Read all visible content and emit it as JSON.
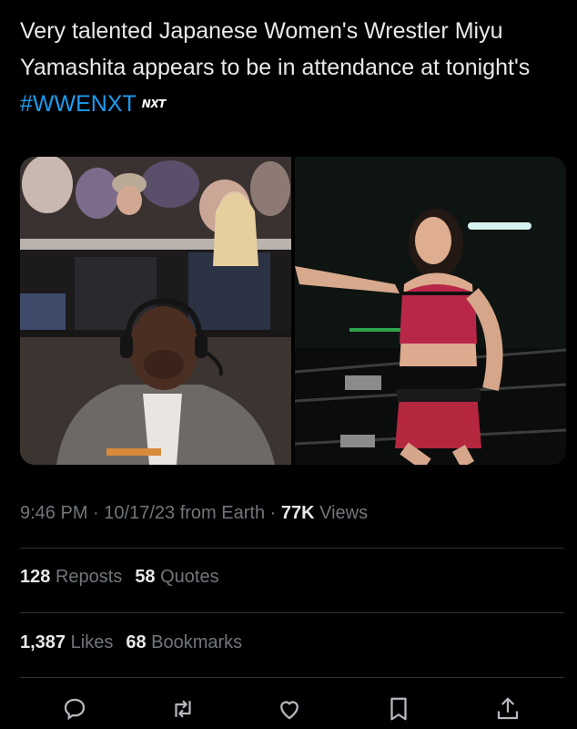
{
  "tweet": {
    "text_before_hashtag": "Very talented Japanese Women's Wrestler Miyu Yamashita appears to be in attendance at tonight's ",
    "hashtag": "#WWENXT",
    "hashtag_badge": "NXT"
  },
  "media": {
    "left_photo": "ringside commentator in headset with crowd behind",
    "right_photo": "wrestler posing in ring"
  },
  "meta": {
    "time": "9:46 PM",
    "separator": "·",
    "date": "10/17/23",
    "source": "from Earth",
    "views_count": "77K",
    "views_label": "Views"
  },
  "stats": {
    "reposts_count": "128",
    "reposts_label": "Reposts",
    "quotes_count": "58",
    "quotes_label": "Quotes",
    "likes_count": "1,387",
    "likes_label": "Likes",
    "bookmarks_count": "68",
    "bookmarks_label": "Bookmarks"
  },
  "actions": [
    "reply-icon",
    "repost-icon",
    "like-icon",
    "bookmark-icon",
    "share-icon"
  ],
  "colors": {
    "background": "#000000",
    "text": "#e7e9ea",
    "muted": "#71767b",
    "link": "#1d9bf0",
    "divider": "#2f3336"
  }
}
